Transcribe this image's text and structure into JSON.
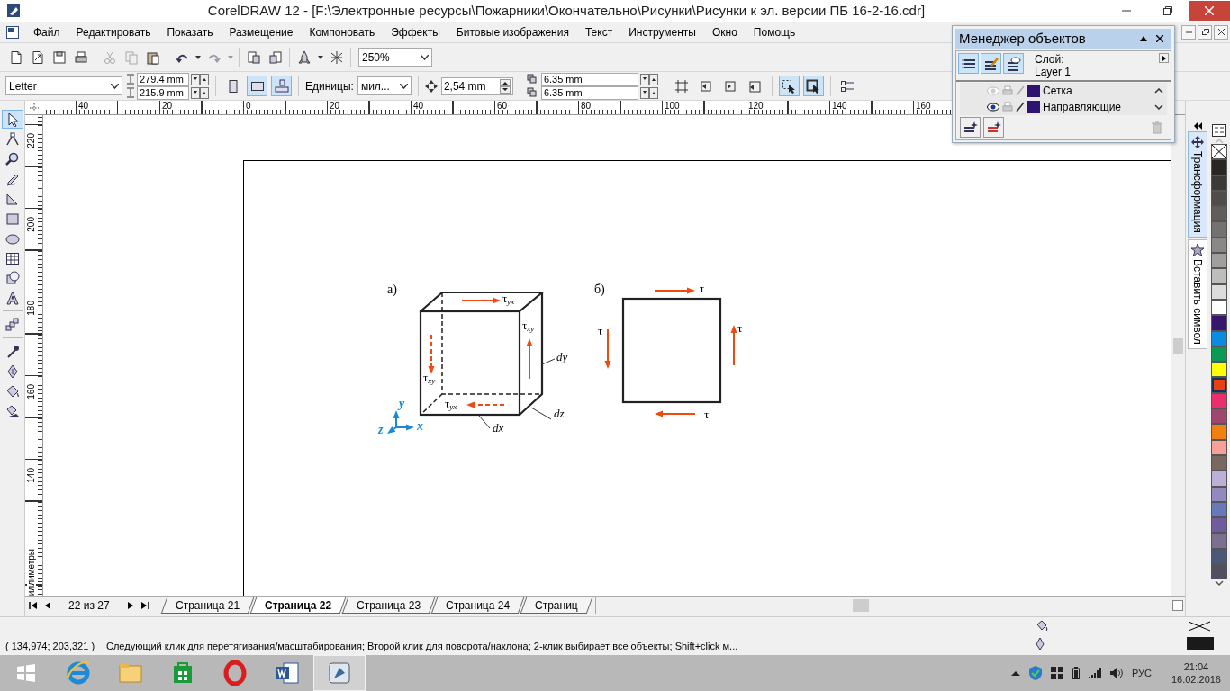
{
  "window": {
    "title": "CorelDRAW 12 - [F:\\Электронные ресурсы\\Пожарники\\Окончательно\\Рисунки\\Рисунки к эл. версии ПБ 16-2-16.cdr]"
  },
  "menu": [
    "Файл",
    "Редактировать",
    "Показать",
    "Размещение",
    "Компоновать",
    "Эффекты",
    "Битовые изображения",
    "Текст",
    "Инструменты",
    "Окно",
    "Помощь"
  ],
  "standard_toolbar": {
    "buttons": [
      {
        "disabled": false
      },
      {
        "disabled": false
      },
      {
        "disabled": false
      },
      {
        "disabled": false
      },
      {
        "disabled": true
      },
      {
        "disabled": true
      },
      {
        "disabled": false
      },
      {
        "disabled": false
      },
      {
        "disabled": false
      },
      {
        "disabled": true
      },
      {
        "disabled": true
      },
      {
        "disabled": false
      },
      {
        "disabled": false
      },
      {
        "disabled": false
      },
      {
        "disabled": false
      },
      {
        "disabled": false
      }
    ],
    "zoom": "250%"
  },
  "property_bar": {
    "paper": "Letter",
    "width": "279.4 mm",
    "height": "215.9 mm",
    "page_buttons": [
      {
        "selected": false
      },
      {
        "selected": true
      },
      {
        "selected": true
      }
    ],
    "units_label": "Единицы:",
    "units": "мил...",
    "nudge": "2,54 mm",
    "duplicate_x": "6.35 mm",
    "duplicate_y": "6.35 mm",
    "tool_buttons": [
      {
        "selected": false
      },
      {
        "selected": false
      },
      {
        "selected": false
      },
      {
        "selected": false
      },
      {
        "selected": true
      },
      {
        "selected": true
      },
      {
        "selected": false
      }
    ]
  },
  "toolbox": [
    {
      "selected": true
    },
    {
      "selected": false
    },
    {
      "selected": false
    },
    {
      "selected": false
    },
    {
      "selected": false
    },
    {
      "selected": false
    },
    {
      "selected": false
    },
    {
      "selected": false
    },
    {
      "selected": false
    },
    {
      "selected": false
    },
    {
      "selected": false
    },
    {
      "selected": false
    },
    {
      "selected": false
    },
    {
      "selected": false
    },
    {
      "selected": false
    }
  ],
  "horizontal_ruler": [
    "40",
    "20",
    "0",
    "20",
    "40",
    "60",
    "80",
    "100",
    "120",
    "140",
    "160"
  ],
  "vertical_ruler": [
    "220",
    "200",
    "180",
    "160",
    "140"
  ],
  "ruler_units": "иллиметры",
  "figure_a": {
    "label": "а)",
    "shear_labels": [
      "τ$_{yx}$",
      "τ$_{xy}$",
      "τ$_{xy}$",
      "τ$_{yx}$"
    ],
    "dimension_labels": [
      "dy",
      "dz",
      "dx"
    ],
    "axis_labels": [
      "y",
      "x",
      "z"
    ]
  },
  "figure_b": {
    "label": "б)",
    "shear_labels": [
      "τ",
      "τ",
      "τ",
      "τ"
    ]
  },
  "page_navigator": {
    "counter": "22 из 27",
    "tabs": [
      {
        "label": "Страница 21",
        "selected": false
      },
      {
        "label": "Страница 22",
        "selected": true
      },
      {
        "label": "Страница 23",
        "selected": false
      },
      {
        "label": "Страница 24",
        "selected": false
      },
      {
        "label": "Страниц",
        "selected": false
      }
    ]
  },
  "object_manager": {
    "title": "Менеджер объектов",
    "view_buttons": [
      {
        "selected": true
      },
      {
        "selected": true
      },
      {
        "selected": true
      }
    ],
    "layer_label": "Слой:",
    "layer": "Layer 1",
    "layers": [
      {
        "name": "Сетка",
        "visible": false
      },
      {
        "name": "Направляющие",
        "visible": true
      }
    ]
  },
  "docker_tabs": [
    {
      "label": "Трансформация",
      "selected": true
    },
    {
      "label": "Вставить символ",
      "selected": false
    }
  ],
  "palette": [
    {
      "kind": "none",
      "selected": false
    },
    {
      "kind": "color",
      "color": "#2a2623",
      "selected": false
    },
    {
      "kind": "color",
      "color": "#3c3936",
      "selected": false
    },
    {
      "kind": "color",
      "color": "#4f4c49",
      "selected": false
    },
    {
      "kind": "color",
      "color": "#605d5b",
      "selected": false
    },
    {
      "kind": "color",
      "color": "#747270",
      "selected": false
    },
    {
      "kind": "color",
      "color": "#8a8887",
      "selected": false
    },
    {
      "kind": "color",
      "color": "#a09f9e",
      "selected": false
    },
    {
      "kind": "color",
      "color": "#bebdbc",
      "selected": false
    },
    {
      "kind": "color",
      "color": "#dcdcdb",
      "selected": false
    },
    {
      "kind": "color",
      "color": "#ffffff",
      "selected": false
    },
    {
      "kind": "color",
      "color": "#35176e",
      "selected": false
    },
    {
      "kind": "color",
      "color": "#0a8ce0",
      "selected": false
    },
    {
      "kind": "color",
      "color": "#0a9a55",
      "selected": false
    },
    {
      "kind": "color",
      "color": "#ffff00",
      "selected": false
    },
    {
      "kind": "color",
      "color": "#e84010",
      "selected": true
    },
    {
      "kind": "color",
      "color": "#ec2e6e",
      "selected": false
    },
    {
      "kind": "color",
      "color": "#a0466e",
      "selected": false
    },
    {
      "kind": "color",
      "color": "#f08010",
      "selected": false
    },
    {
      "kind": "color",
      "color": "#f8a098",
      "selected": false
    },
    {
      "kind": "color",
      "color": "#786860",
      "selected": false
    },
    {
      "kind": "color",
      "color": "#bcb0d8",
      "selected": false
    },
    {
      "kind": "color",
      "color": "#9488c0",
      "selected": false
    },
    {
      "kind": "color",
      "color": "#6878b8",
      "selected": false
    },
    {
      "kind": "color",
      "color": "#705c9c",
      "selected": false
    },
    {
      "kind": "color",
      "color": "#7c7090",
      "selected": false
    },
    {
      "kind": "color",
      "color": "#4c5878",
      "selected": false
    },
    {
      "kind": "color",
      "color": "#505060",
      "selected": false
    }
  ],
  "status_bar": {
    "coordinates": "( 134,974; 203,321 )",
    "hint": "Следующий клик для перетягивания/масштабирования; Второй клик для поворота/наклона; 2-клик выбирает все объекты; Shift+click м..."
  },
  "taskbar": {
    "apps": [
      {
        "selected": false
      },
      {
        "selected": false
      },
      {
        "selected": false
      },
      {
        "selected": false
      },
      {
        "selected": false
      },
      {
        "selected": true
      }
    ],
    "language": "РУС",
    "time": "21:04",
    "date": "16.02.2016"
  }
}
